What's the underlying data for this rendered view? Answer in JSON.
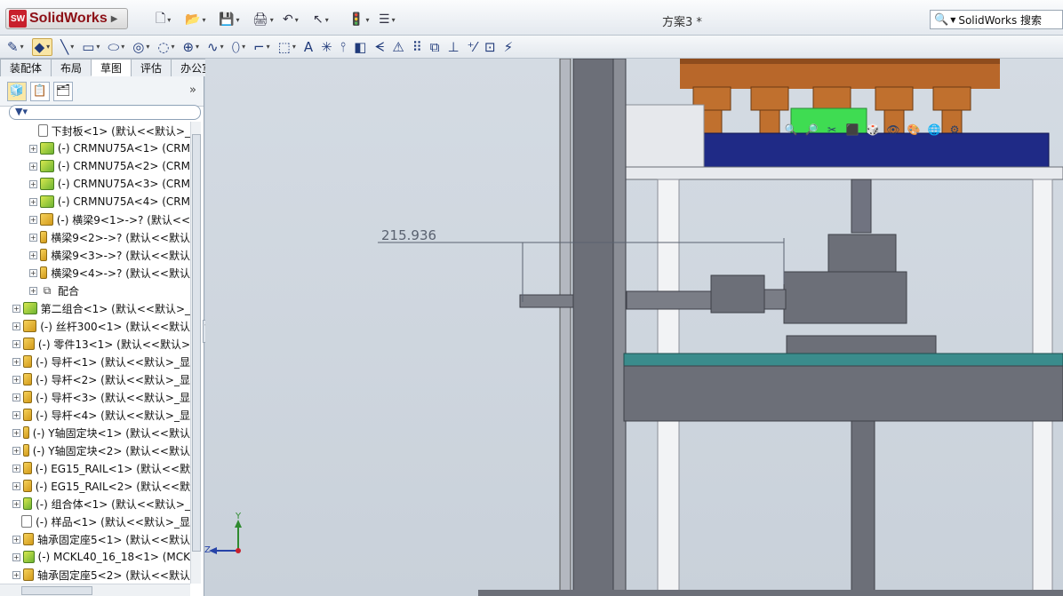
{
  "app": {
    "logo_text": "SolidWorks",
    "logo_badge": "SW",
    "document_title": "方案3 *",
    "search_placeholder": "SolidWorks 搜索"
  },
  "quick_access": [
    {
      "name": "new-file-icon",
      "glyph": "🗋"
    },
    {
      "name": "open-file-icon",
      "glyph": "📂"
    },
    {
      "name": "save-icon",
      "glyph": "💾"
    },
    {
      "name": "print-icon",
      "glyph": "🖨"
    },
    {
      "name": "undo-icon",
      "glyph": "↶"
    },
    {
      "name": "select-icon",
      "glyph": "↖"
    },
    {
      "name": "rebuild-icon",
      "glyph": "🚦"
    },
    {
      "name": "options-icon",
      "glyph": "☰"
    }
  ],
  "sketch_tools": [
    {
      "name": "sketch-tool-icon",
      "glyph": "✎",
      "selected": false
    },
    {
      "name": "smart-dimension-icon",
      "glyph": "◆",
      "selected": true
    },
    {
      "name": "line-icon",
      "glyph": "╲",
      "selected": false
    },
    {
      "name": "rectangle-icon",
      "glyph": "▭",
      "selected": false
    },
    {
      "name": "slot-icon",
      "glyph": "⬭",
      "selected": false
    },
    {
      "name": "circle-icon",
      "glyph": "◎",
      "selected": false
    },
    {
      "name": "arc-icon",
      "glyph": "◌",
      "selected": false
    },
    {
      "name": "polygon-icon",
      "glyph": "⊕",
      "selected": false
    },
    {
      "name": "spline-icon",
      "glyph": "∿",
      "selected": false
    },
    {
      "name": "ellipse-icon",
      "glyph": "⬯",
      "selected": false
    },
    {
      "name": "fillet-icon",
      "glyph": "⌐",
      "selected": false
    },
    {
      "name": "plane-icon",
      "glyph": "⬚",
      "selected": false
    },
    {
      "name": "text-icon",
      "glyph": "A",
      "selected": false
    },
    {
      "name": "point-icon",
      "glyph": "✳",
      "selected": false
    },
    {
      "name": "trim-icon",
      "glyph": "⫯",
      "selected": false
    },
    {
      "name": "offset-icon",
      "glyph": "◧",
      "selected": false
    },
    {
      "name": "mirror-icon",
      "glyph": "ᗕ",
      "selected": false
    },
    {
      "name": "convert-icon",
      "glyph": "⚠",
      "selected": false
    },
    {
      "name": "pattern-icon",
      "glyph": "⠿",
      "selected": false
    },
    {
      "name": "move-icon",
      "glyph": "⧉",
      "selected": false
    },
    {
      "name": "relations-icon",
      "glyph": "⊥",
      "selected": false
    },
    {
      "name": "repair-icon",
      "glyph": "⁺⁄",
      "selected": false
    },
    {
      "name": "quick-snaps-icon",
      "glyph": "⊡",
      "selected": false
    },
    {
      "name": "rapid-sketch-icon",
      "glyph": "⚡",
      "selected": false
    }
  ],
  "tabs": [
    "装配体",
    "布局",
    "草图",
    "评估",
    "办公室产品"
  ],
  "active_tab": 2,
  "panel_tabs": [
    "feature-manager-icon",
    "property-manager-icon",
    "configuration-manager-icon"
  ],
  "tree": [
    {
      "label": "下封板<1> (默认<<默认>_",
      "type": "ghost",
      "level": 2,
      "expander": false
    },
    {
      "label": "(-) CRMNU75A<1> (CRM",
      "type": "asm",
      "level": 2,
      "expander": true
    },
    {
      "label": "(-) CRMNU75A<2> (CRM",
      "type": "asm",
      "level": 2,
      "expander": true
    },
    {
      "label": "(-) CRMNU75A<3> (CRM",
      "type": "asm",
      "level": 2,
      "expander": true
    },
    {
      "label": "(-) CRMNU75A<4> (CRM",
      "type": "asm",
      "level": 2,
      "expander": true
    },
    {
      "label": "(-) 横梁9<1>->? (默认<<",
      "type": "part",
      "level": 2,
      "expander": true
    },
    {
      "label": "横梁9<2>->? (默认<<默认",
      "type": "part",
      "level": 2,
      "expander": true
    },
    {
      "label": "横梁9<3>->? (默认<<默认",
      "type": "part",
      "level": 2,
      "expander": true
    },
    {
      "label": "横梁9<4>->? (默认<<默认",
      "type": "part",
      "level": 2,
      "expander": true
    },
    {
      "label": "配合",
      "type": "mate",
      "level": 2,
      "expander": true
    },
    {
      "label": "第二组合<1> (默认<<默认>_",
      "type": "asm",
      "level": 1,
      "expander": true
    },
    {
      "label": "(-) 丝杆300<1> (默认<<默认",
      "type": "part",
      "level": 1,
      "expander": true
    },
    {
      "label": "(-) 零件13<1> (默认<<默认>",
      "type": "part",
      "level": 1,
      "expander": true
    },
    {
      "label": "(-) 导杆<1> (默认<<默认>_显",
      "type": "part",
      "level": 1,
      "expander": true
    },
    {
      "label": "(-) 导杆<2> (默认<<默认>_显",
      "type": "part",
      "level": 1,
      "expander": true
    },
    {
      "label": "(-) 导杆<3> (默认<<默认>_显",
      "type": "part",
      "level": 1,
      "expander": true
    },
    {
      "label": "(-) 导杆<4> (默认<<默认>_显",
      "type": "part",
      "level": 1,
      "expander": true
    },
    {
      "label": "(-) Y轴固定块<1> (默认<<默认",
      "type": "part",
      "level": 1,
      "expander": true
    },
    {
      "label": "(-) Y轴固定块<2> (默认<<默认",
      "type": "part",
      "level": 1,
      "expander": true
    },
    {
      "label": "(-) EG15_RAIL<1> (默认<<默",
      "type": "part",
      "level": 1,
      "expander": true
    },
    {
      "label": "(-) EG15_RAIL<2> (默认<<默",
      "type": "part",
      "level": 1,
      "expander": true
    },
    {
      "label": "(-) 组合体<1> (默认<<默认>_",
      "type": "asm",
      "level": 1,
      "expander": true
    },
    {
      "label": "(-) 样品<1> (默认<<默认>_显",
      "type": "ghost",
      "level": 1,
      "expander": false
    },
    {
      "label": "轴承固定座5<1> (默认<<默认",
      "type": "part",
      "level": 1,
      "expander": true
    },
    {
      "label": "(-) MCKL40_16_18<1> (MCK",
      "type": "asm",
      "level": 1,
      "expander": true
    },
    {
      "label": "轴承固定座5<2> (默认<<默认",
      "type": "part",
      "level": 1,
      "expander": true
    }
  ],
  "viewport": {
    "dimension_value": "215.936",
    "axis_x_label": "Z",
    "axis_y_label": "Y"
  },
  "colors": {
    "frame_gray": "#6c6f78",
    "frame_dark": "#3e4048",
    "bronze": "#b8672a",
    "navy": "#1f2a86",
    "teal": "#3a8c8c",
    "green": "#3fdc52"
  }
}
